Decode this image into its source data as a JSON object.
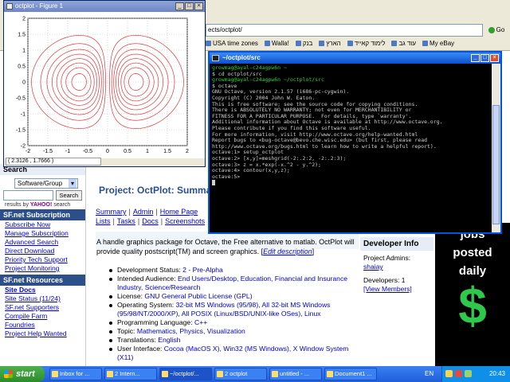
{
  "browser": {
    "address_value": "ects/octplot/",
    "go_label": "Go",
    "links": [
      "USA time zones",
      "Walla!",
      "בנק",
      "הארץ",
      "לימוד קאייד",
      "עוד גב",
      "My eBay"
    ]
  },
  "figure": {
    "title": "octplot - Figure 1",
    "status": "( 2.3126 , 1.7666 )",
    "chart_data": {
      "type": "contour",
      "function": "z = x .* exp(-x.^2 - y.^2)",
      "x_range": [
        -2,
        2
      ],
      "y_range": [
        -2,
        2
      ],
      "xticks": [
        "-2",
        "-1.5",
        "-1",
        "-0.5",
        "0",
        "0.5",
        "1",
        "1.5",
        "2"
      ],
      "yticks": [
        "-2",
        "-1.5",
        "-1",
        "-0.5",
        "0",
        "0.5",
        "1",
        "1.5",
        "2"
      ],
      "levels": [
        0.05,
        0.1,
        0.15,
        0.2,
        0.25,
        0.3,
        0.35,
        0.4
      ],
      "grid": true,
      "color": "#e0353b"
    }
  },
  "terminal": {
    "title": "~/octplot/src",
    "lines": [
      {
        "c": "g",
        "t": "growmag@ayal-c24agpw6n ~"
      },
      {
        "c": "w",
        "t": "$ cd octplot/src"
      },
      {
        "c": "w",
        "t": ""
      },
      {
        "c": "g",
        "t": "growmag@ayal-c24agpw6n ~/octplot/src"
      },
      {
        "c": "w",
        "t": "$ octave"
      },
      {
        "c": "w",
        "t": "GNU Octave, version 2.1.57 (i686-pc-cygwin)."
      },
      {
        "c": "w",
        "t": "Copyright (C) 2004 John W. Eaton."
      },
      {
        "c": "w",
        "t": "This is free software; see the source code for copying conditions."
      },
      {
        "c": "w",
        "t": "There is ABSOLUTELY NO WARRANTY; not even for MERCHANTIBILITY or"
      },
      {
        "c": "w",
        "t": "FITNESS FOR A PARTICULAR PURPOSE.  For details, type `warranty'."
      },
      {
        "c": "w",
        "t": ""
      },
      {
        "c": "w",
        "t": "Additional information about Octave is available at http://www.octave.org."
      },
      {
        "c": "w",
        "t": ""
      },
      {
        "c": "w",
        "t": "Please contribute if you find this software useful."
      },
      {
        "c": "w",
        "t": "For more information, visit http://www.octave.org/help-wanted.html"
      },
      {
        "c": "w",
        "t": ""
      },
      {
        "c": "w",
        "t": "Report bugs to <bug-octave@bevo.che.wisc.edu> (but first, please read"
      },
      {
        "c": "w",
        "t": "http://www.octave.org/bugs.html to learn how to write a helpful report)."
      },
      {
        "c": "w",
        "t": ""
      },
      {
        "c": "w",
        "t": "octave:1> setup_octplot"
      },
      {
        "c": "w",
        "t": "octave:2> [x,y]=meshgrid(-2:.2:2, -2:.2:3);"
      },
      {
        "c": "w",
        "t": "octave:3> z = x.*exp(-x.^2 - y.^2);"
      },
      {
        "c": "w",
        "t": "octave:4> contour(x,y,z);"
      },
      {
        "c": "w",
        "t": "octave:5> "
      }
    ]
  },
  "sidebar": {
    "search_heading": "Search",
    "select_value": "Software/Group",
    "search_button": "Search",
    "yahoo_note_prefix": "results by",
    "yahoo_brand": "YAHOO!",
    "yahoo_note_suffix": "search",
    "subscription_heading": "SF.net Subscription",
    "subscription_links": [
      "Subscribe Now",
      "Manage Subscription",
      "Advanced Search",
      "Direct Download",
      "Priority Tech Support",
      "Project Monitoring"
    ],
    "resources_heading": "SF.net Resources",
    "resource_links": [
      "Site Docs",
      "Site Status (11/24)",
      "SF.net Supporters",
      "Compile Farm",
      "Foundries",
      "Project Help Wanted"
    ]
  },
  "project": {
    "title": "Project: OctPlot: Summary",
    "nav": [
      "Summary",
      "Admin",
      "Home Page",
      "Lists",
      "Tasks",
      "Docs",
      "Screenshots"
    ],
    "desc": "A handle graphics package for Octave, the Free alternative to matlab. OctPlot will provide quality postscript(TM) and screen graphics. [",
    "desc_link": "Edit description",
    "desc_end": "]",
    "info": [
      {
        "k": "Development Status: ",
        "v": "2 - Pre-Alpha"
      },
      {
        "k": "Intended Audience: ",
        "v": "End Users/Desktop, Education, Financial and Insurance Industry, Science/Research"
      },
      {
        "k": "License: ",
        "v": "GNU General Public License (GPL)"
      },
      {
        "k": "Operating System: ",
        "v": "32-bit MS Windows (95/98), All 32-bit MS Windows (95/98/NT/2000/XP), All POSIX (Linux/BSD/UNIX-like OSes), Linux"
      },
      {
        "k": "Programming Language: ",
        "v": "C++"
      },
      {
        "k": "Topic: ",
        "v": "Mathematics, Physics, Visualization"
      },
      {
        "k": "Translations: ",
        "v": "English"
      },
      {
        "k": "User Interface: ",
        "v": "Cocoa (MacOS X), Win32 (MS Windows), X Window System (X11)"
      }
    ]
  },
  "developer": {
    "heading": "Developer Info",
    "admins_label": "Project Admins:",
    "admin": "shaiay",
    "developers": "Developers: 1",
    "view_members": "[View Members]"
  },
  "ad": {
    "line1": "jobs",
    "line2": "posted",
    "line3": "daily",
    "symbol": "$"
  },
  "taskbar": {
    "start": "start",
    "items": [
      "Inbox for ...",
      "2 Intern...",
      "~/octplot/...",
      "2 octplot",
      "untitled - ...",
      "Document1 ..."
    ],
    "lang": "EN",
    "clock": "20:43"
  }
}
